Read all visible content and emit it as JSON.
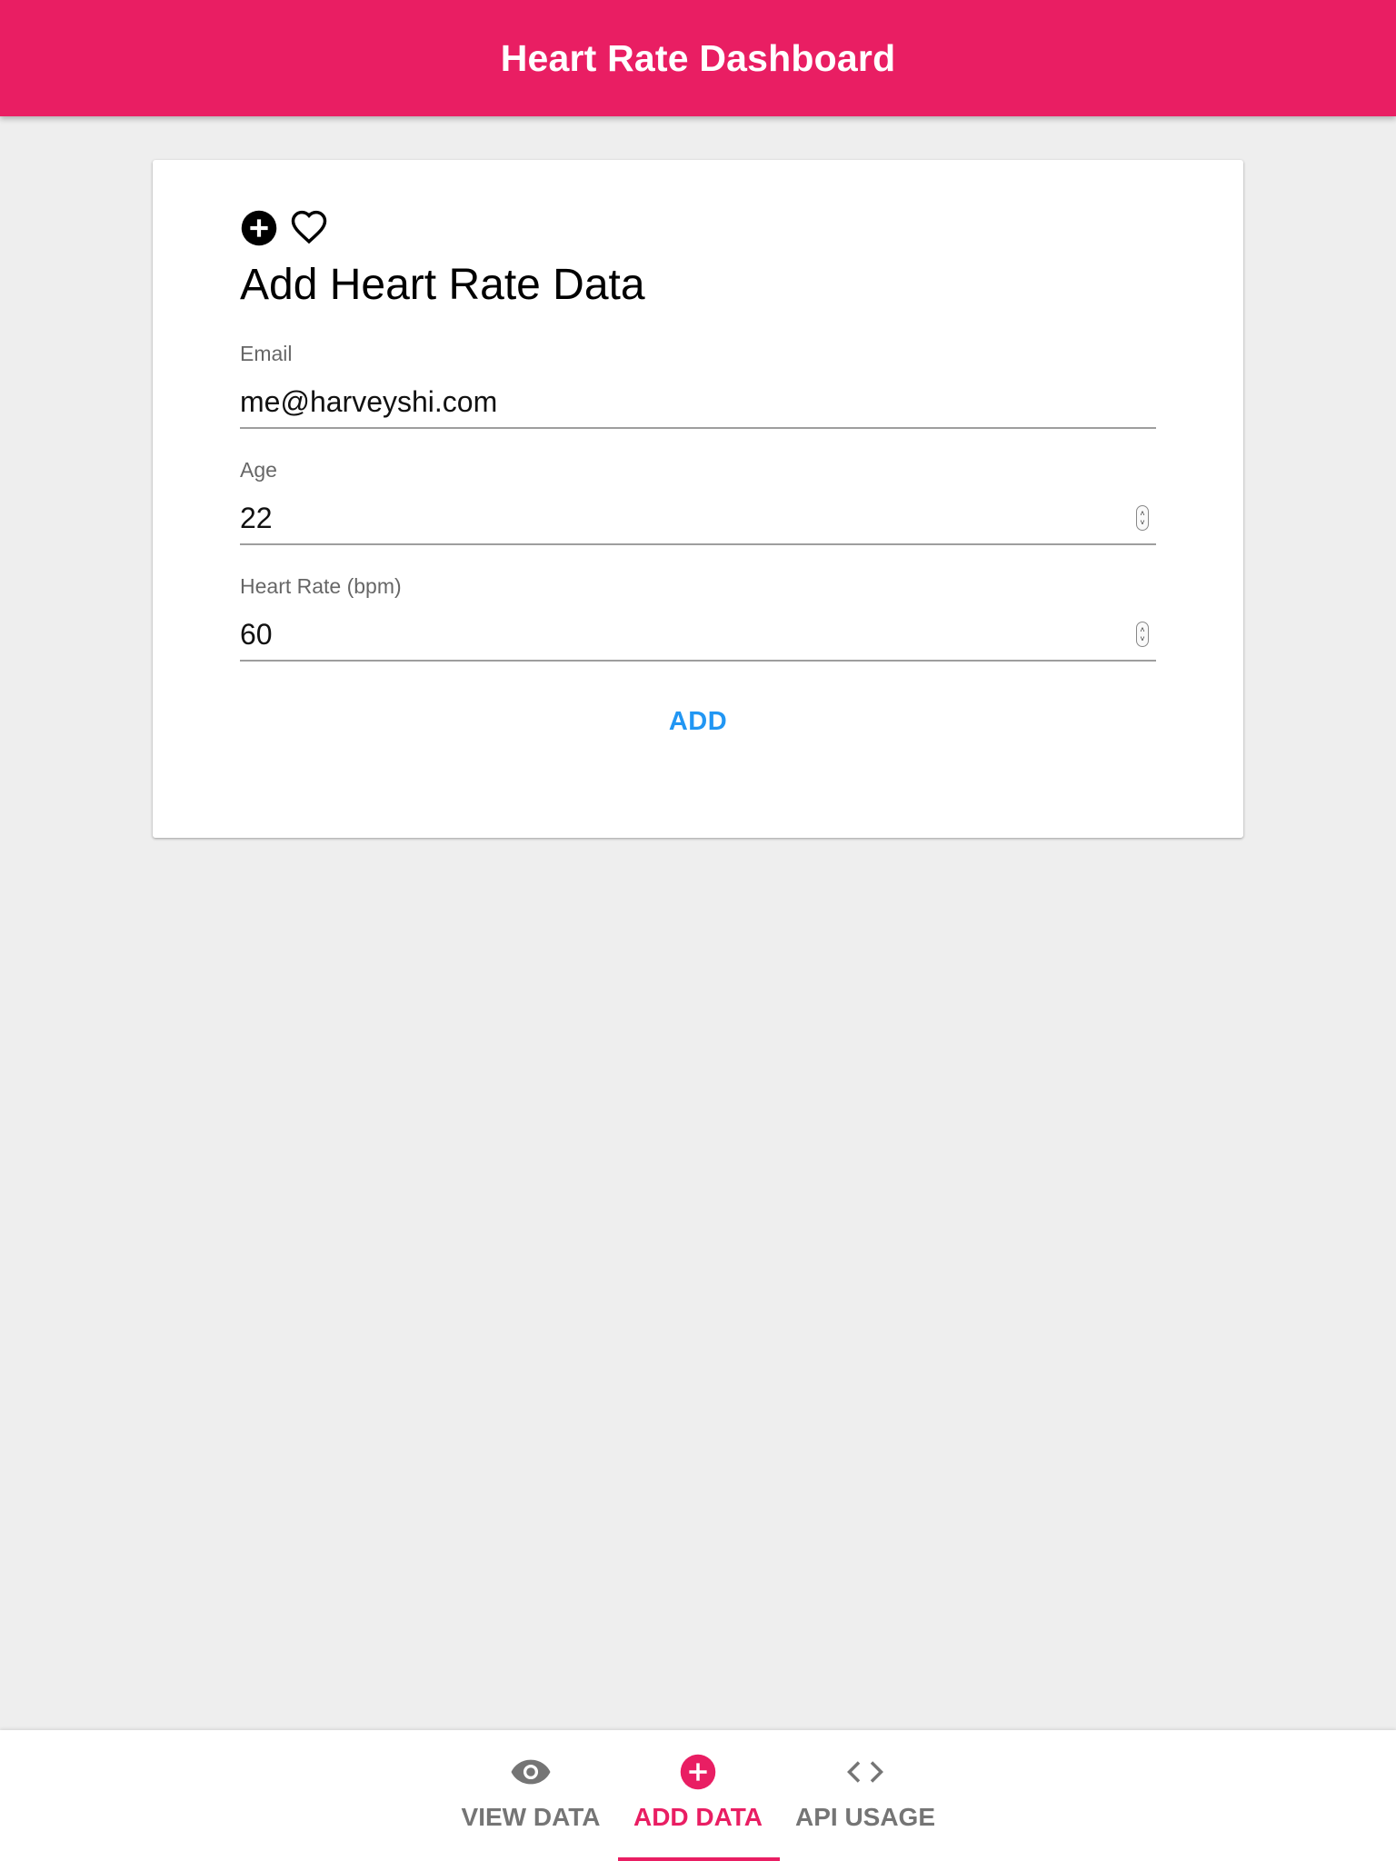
{
  "header": {
    "title": "Heart Rate Dashboard",
    "background_color": "#e91e63"
  },
  "card": {
    "icons": [
      "plus-circle-icon",
      "heart-outline-icon"
    ],
    "title": "Add Heart Rate Data",
    "fields": [
      {
        "label": "Email",
        "value": "me@harveyshi.com",
        "type": "email"
      },
      {
        "label": "Age",
        "value": "22",
        "type": "number"
      },
      {
        "label": "Heart Rate (bpm)",
        "value": "60",
        "type": "number"
      }
    ],
    "submit_label": "ADD",
    "submit_color": "#2196f3"
  },
  "bottom_nav": {
    "items": [
      {
        "label": "VIEW DATA",
        "icon": "eye-icon",
        "active": false
      },
      {
        "label": "ADD DATA",
        "icon": "plus-circle-icon",
        "active": true
      },
      {
        "label": "API USAGE",
        "icon": "code-icon",
        "active": false
      }
    ],
    "active_color": "#e91e63",
    "inactive_color": "#757575"
  }
}
